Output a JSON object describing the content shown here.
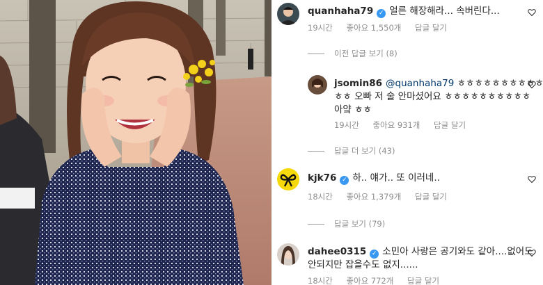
{
  "comments": [
    {
      "username": "quanhaha79",
      "verified": true,
      "text": "얼른 해장해라... 속버린다...",
      "time": "19시간",
      "likes": "좋아요 1,550개",
      "reply": "답글 달기"
    },
    {
      "username": "kjk76",
      "verified": true,
      "text": "하.. 얘가.. 또 이러네..",
      "time": "18시간",
      "likes": "좋아요 1,379개",
      "reply": "답글 달기"
    },
    {
      "username": "dahee0315",
      "verified": true,
      "text_line1": "소민아 사랑은 공기와도 같아....없어도",
      "text_line2": "안되지만 잡을수도 없지......",
      "time": "18시간",
      "likes": "좋아요 772개",
      "reply": "답글 달기"
    }
  ],
  "reply": {
    "username": "jsomin86",
    "mention": "@quanhaha79",
    "text_line1_rest": " ㅎㅎㅎㅎㅎㅎㅎㅎㅎㅎ",
    "text_line2": "ㅎㅎ 오빠 저 술 안마셨어요 ㅎㅎㅎㅎㅎㅎㅎㅎㅎㅎ",
    "text_line3": "아얔 ㅎㅎ",
    "time": "19시간",
    "likes": "좋아요 931개",
    "reply": "답글 달기"
  },
  "threads": {
    "prev_replies": "이전 답글 보기 (8)",
    "more_replies": "답글 더 보기 (43)",
    "view_replies": "답글 보기 (79)"
  },
  "colors": {
    "verified": "#3897f0",
    "meta": "#8e8e8e",
    "mention": "#00376b"
  }
}
